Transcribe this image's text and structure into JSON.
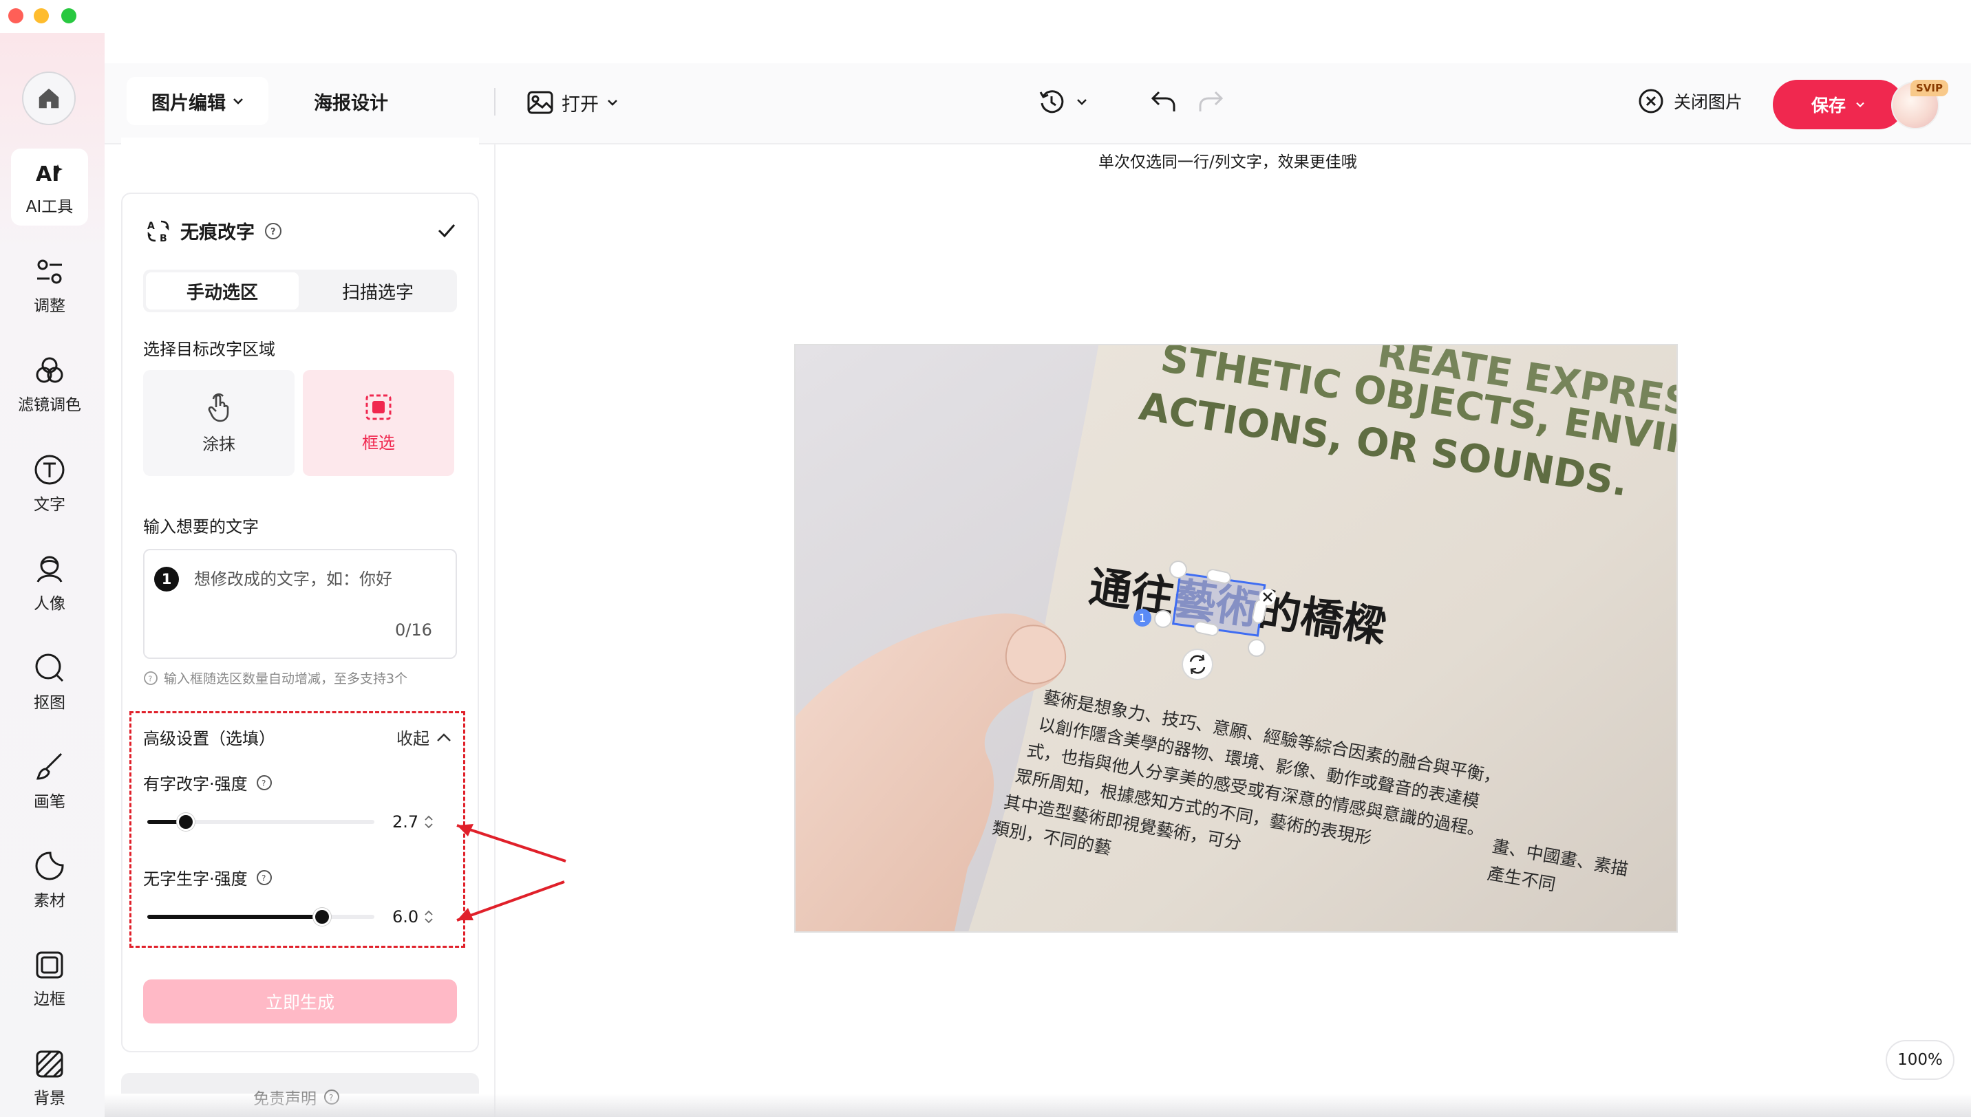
{
  "rail": {
    "items": [
      {
        "label": "AI工具",
        "icon": "ai-tools-icon"
      },
      {
        "label": "调整",
        "icon": "adjust-icon"
      },
      {
        "label": "滤镜调色",
        "icon": "filter-icon"
      },
      {
        "label": "文字",
        "icon": "text-icon"
      },
      {
        "label": "人像",
        "icon": "portrait-icon"
      },
      {
        "label": "抠图",
        "icon": "cutout-icon"
      },
      {
        "label": "画笔",
        "icon": "brush-icon"
      },
      {
        "label": "素材",
        "icon": "sticker-icon"
      },
      {
        "label": "边框",
        "icon": "frame-icon"
      },
      {
        "label": "背景",
        "icon": "background-icon"
      }
    ]
  },
  "header": {
    "tab_edit": "图片编辑",
    "tab_poster": "海报设计",
    "open": "打开",
    "close_image": "关闭图片",
    "save": "保存",
    "svip": "SVIP"
  },
  "panel": {
    "section_title": "无痕改字",
    "seg_manual": "手动选区",
    "seg_scan": "扫描选字",
    "select_area_label": "选择目标改字区域",
    "mode_smear": "涂抹",
    "mode_box": "框选",
    "input_label": "输入想要的文字",
    "badge": "1",
    "input_placeholder": "想修改成的文字，如：你好",
    "input_count": "0/16",
    "hint": "输入框随选区数量自动增减，至多支持3个",
    "advanced_title": "高级设置（选填）",
    "collapse": "收起",
    "slider1_label": "有字改字·强度",
    "slider1_value": "2.7",
    "slider1_fraction": 0.17,
    "slider2_label": "无字生字·强度",
    "slider2_value": "6.0",
    "slider2_fraction": 0.77,
    "generate": "立即生成",
    "disclaimer": "免责声明"
  },
  "canvas": {
    "tip": "单次仅选同一行/列文字，效果更佳哦",
    "zoom": "100%",
    "photo_text": {
      "line1": "STHETIC OBJECTS, ENVIRON",
      "line0": "REATE EXPRESSI",
      "line2": "ACTIONS, OR SOUNDS.",
      "headline_a": "通往",
      "headline_sel": "藝術",
      "headline_b": "的橋樑",
      "selection_badge": "1",
      "body1": "藝術是想象力、技巧、意願、經驗等綜合因素的融合與平衡，",
      "body2": "以創作隱含美學的器物、環境、影像、動作或聲音的表達模",
      "body3": "式，也指與他人分享美的感受或有深意的情感與意識的過程。",
      "body4": "眾所周知，根據感知方式的不同，藝術的表現形",
      "body5": "其中造型藝術即視覺藝術，可分",
      "body6": "類別，不同的藝",
      "side1": "畫、中國畫、素描",
      "side2": "產生不同"
    }
  },
  "colors": {
    "accent": "#f0284f",
    "highlight_box": "#e0202a"
  }
}
